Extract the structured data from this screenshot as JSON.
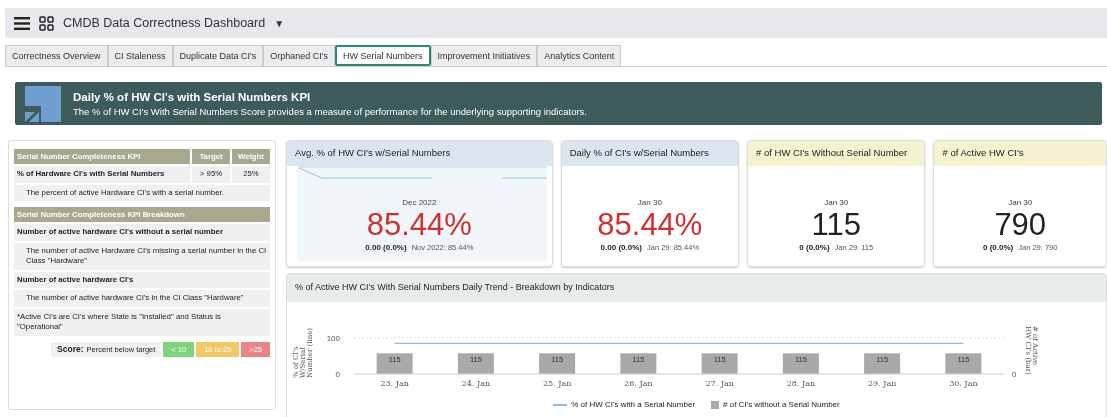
{
  "app_bar": {
    "title": "CMDB Data Correctness Dashboard",
    "caret": "▼"
  },
  "tabs": [
    {
      "label": "Correctness Overview",
      "selected": false
    },
    {
      "label": "CI Staleness",
      "selected": false
    },
    {
      "label": "Duplicate Data CI's",
      "selected": false
    },
    {
      "label": "Orphaned CI's",
      "selected": false
    },
    {
      "label": "HW Serial Numbers",
      "selected": true
    },
    {
      "label": "Improvement Initiatives",
      "selected": false
    },
    {
      "label": "Analytics Content",
      "selected": false
    }
  ],
  "banner": {
    "title": "Daily % of HW CI's with Serial Numbers KPI",
    "subtitle": "The % of HW CI's With Serial Numbers Score provides a measure of performance for the underlying supporting indicators."
  },
  "kpi_table": {
    "columns": [
      "Serial Number Completeness KPI",
      "Target",
      "Weight"
    ],
    "kpi": {
      "name": "% of Hardware CI's with Serial Numbers",
      "target": "> 95%",
      "weight": "25%",
      "description": "The percent of active Hardware CI's with a serial number."
    },
    "breakdown_title": "Serial Number Completeness KPI Breakdown",
    "indicators": [
      {
        "name": "Number of active hardware CI's without a serial number",
        "description": "The number of active Hardware CI's missing a serial number in the CI Class \"Hardware\""
      },
      {
        "name": "Number of active hardware CI's",
        "description": "The number of active hardware CI's in the CI Class \"Hardware\""
      }
    ],
    "note": "*Active CI's are CI's where State is \"Installed\" and Status is \"Operational\"",
    "score": {
      "label": "Score:",
      "hint": "Percent below target",
      "levels": [
        {
          "label": "< 10",
          "color": "#7dd47d"
        },
        {
          "label": "10 to 25",
          "color": "#f2c766"
        },
        {
          "label": ">25",
          "color": "#e98585"
        }
      ]
    }
  },
  "cards": [
    {
      "title": "Avg. % of HW CI's w/Serial Numbers",
      "kind": "percent",
      "sparkline": true,
      "period": "Dec 2022",
      "value": "85.44%",
      "change": "0.00 (0.0%)",
      "previous": "Nov 2022: 85.44%"
    },
    {
      "title": "Daily % of CI's w/Serial Numbers",
      "kind": "percent",
      "sparkline": false,
      "period": "Jan 30",
      "value": "85.44%",
      "change": "0.00 (0.0%)",
      "previous": "Jan 29: 85.44%"
    },
    {
      "title": "# of HW CI's Without Serial Number",
      "kind": "count",
      "sparkline": false,
      "period": "Jan 30",
      "value": "115",
      "change": "0 (0.0%)",
      "previous": "Jan 29: 115"
    },
    {
      "title": "# of Active HW CI's",
      "kind": "count",
      "sparkline": false,
      "period": "Jan 30",
      "value": "790",
      "change": "0 (0.0%)",
      "previous": "Jan 29: 790"
    }
  ],
  "trend": {
    "right_axis_tick": "0",
    "title": "% of Active HW CI's With Serial Numbers Daily Trend - Breakdown by Indicators",
    "chart_data": {
      "type": "bar",
      "ylabel": "% of CI's W/Serial Number (line)",
      "y2label": "# of Active HW CI's (bar)",
      "categories": [
        "23. Jan",
        "24. Jan",
        "25. Jan",
        "26. Jan",
        "27. Jan",
        "28. Jan",
        "29. Jan",
        "30. Jan"
      ],
      "ylim": [
        0,
        100
      ],
      "yticks": [
        0,
        100
      ],
      "series": [
        {
          "name": "% of HW CI's with a Serial Number",
          "type": "line",
          "color": "#8fbbe0",
          "values": [
            85,
            85,
            85,
            85,
            85,
            85,
            85,
            85
          ]
        },
        {
          "name": "# of CI's without a Serial Number",
          "type": "bar",
          "color": "#a9a9a9",
          "values": [
            null,
            null,
            null,
            null,
            null,
            null,
            null,
            null
          ],
          "value_labels": [
            "115",
            "115",
            "115",
            "115",
            "115",
            "115",
            "115",
            "115"
          ]
        }
      ]
    }
  }
}
